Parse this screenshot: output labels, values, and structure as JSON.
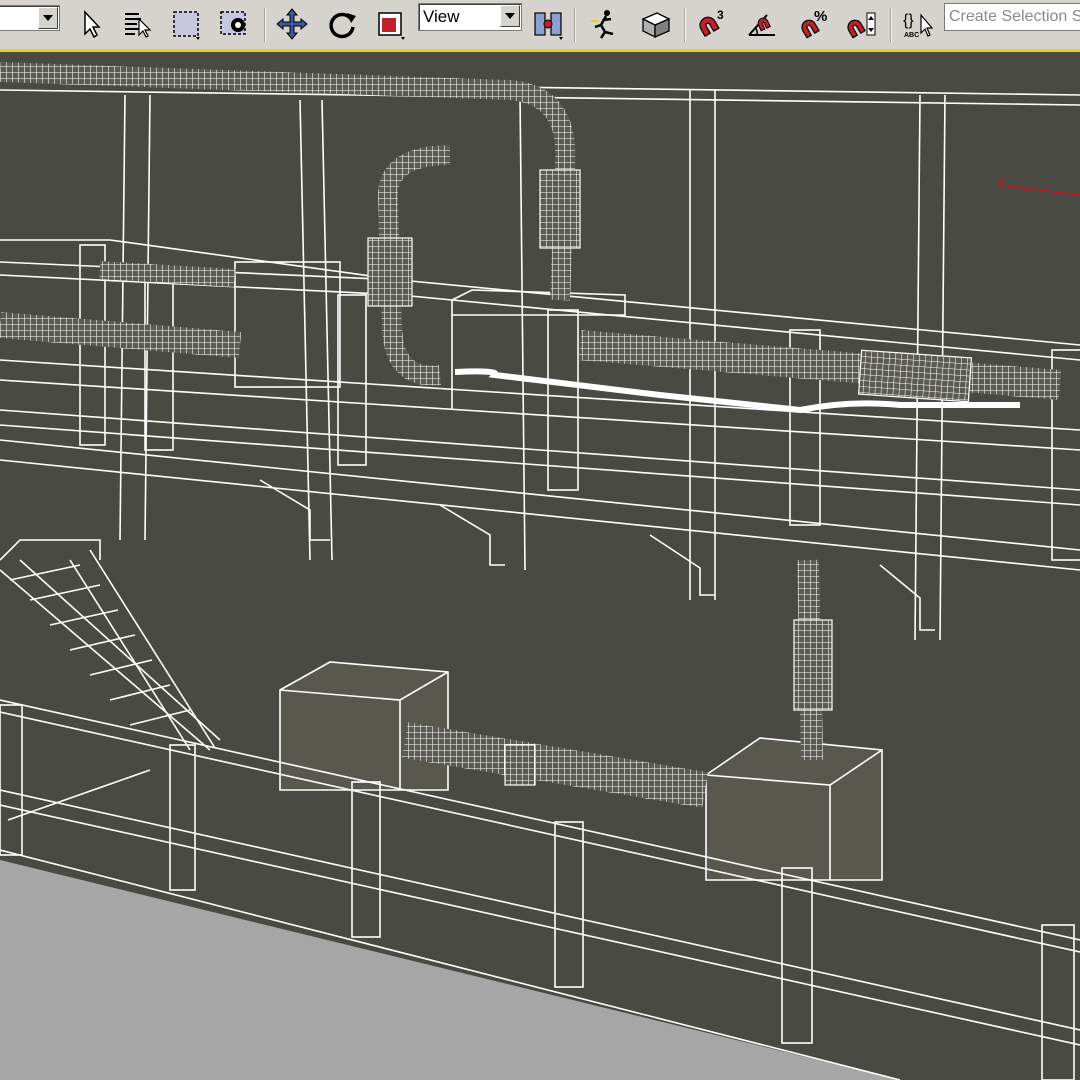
{
  "toolbar": {
    "filter_dropdown": {
      "value": ""
    },
    "icons": [
      "select-object-icon",
      "select-by-name-icon",
      "rectangular-selection-region-icon",
      "window-crossing-icon",
      "select-and-move-icon",
      "select-and-rotate-icon",
      "select-and-scale-icon"
    ],
    "ref_coord_dropdown": {
      "value": "View"
    },
    "icons2": [
      "use-pivot-center-icon",
      "select-and-manipulate-icon",
      "keyboard-shortcut-override-icon",
      "snaps-toggle-icon",
      "angle-snap-icon",
      "percent-snap-icon",
      "spinner-snap-icon",
      "edit-named-selection-sets-icon"
    ],
    "snap_label": "3",
    "percent_label": "%",
    "named_sets_label": "ABC",
    "named_selection_placeholder": "Create Selection Set"
  },
  "viewport": {
    "name": "perspective-viewport",
    "background": "#4a4a44",
    "floor_color": "#a6a6a6",
    "wire_color": "#ffffff",
    "axis_color": "#c8141e",
    "axis_label": "y",
    "shaded_color": "#58584f"
  },
  "colors": {
    "toolbar_bg": "#d6d3ce",
    "accent": "#e8cf1a",
    "magnet_red": "#c0202a"
  }
}
